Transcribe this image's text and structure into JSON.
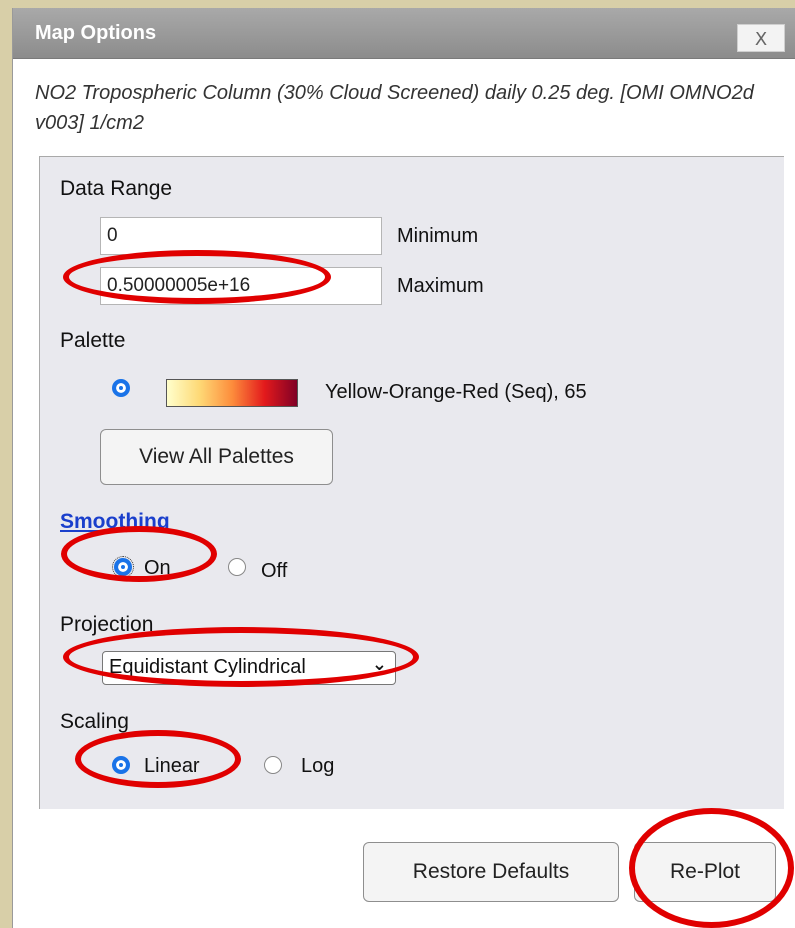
{
  "dialog": {
    "title": "Map Options",
    "close_label": "X",
    "description": "NO2 Tropospheric Column (30% Cloud Screened) daily 0.25 deg. [OMI OMNO2d v003] 1/cm2"
  },
  "data_range": {
    "heading": "Data Range",
    "minimum_value": "0",
    "minimum_label": "Minimum",
    "maximum_value": "0.50000005e+16",
    "maximum_label": "Maximum"
  },
  "palette": {
    "heading": "Palette",
    "selected_name": "Yellow-Orange-Red (Seq), 65",
    "view_all_button": "View All Palettes",
    "colors": [
      "#ffffcc",
      "#fed976",
      "#fd8d3c",
      "#e31a1c",
      "#800026"
    ]
  },
  "smoothing": {
    "heading": "Smoothing",
    "on_label": "On",
    "off_label": "Off",
    "selected": "On"
  },
  "projection": {
    "heading": "Projection",
    "selected": "Equidistant Cylindrical"
  },
  "scaling": {
    "heading": "Scaling",
    "linear_label": "Linear",
    "log_label": "Log",
    "selected": "Linear"
  },
  "footer": {
    "restore_button": "Restore Defaults",
    "replot_button": "Re-Plot"
  },
  "annotations": {
    "highlight_color": "#e00000"
  }
}
